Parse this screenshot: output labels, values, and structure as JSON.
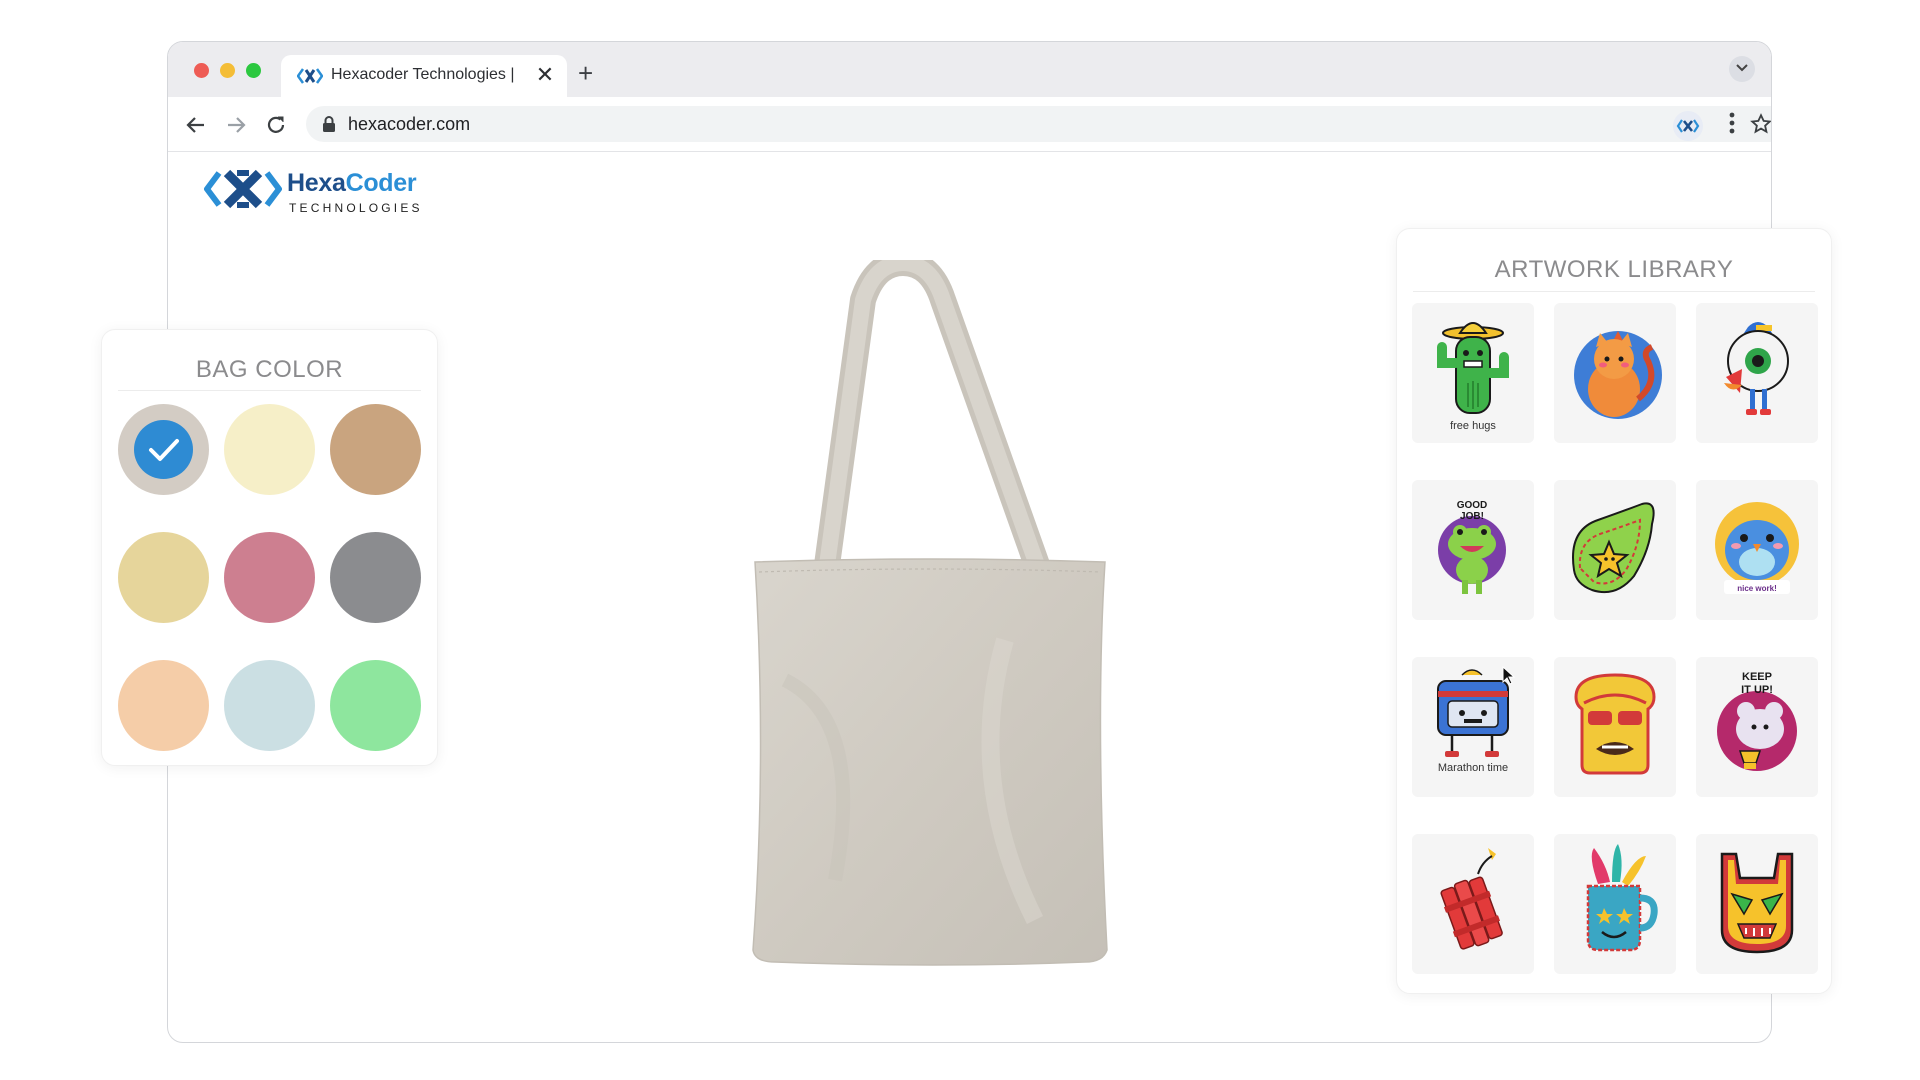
{
  "browser": {
    "tab_title": "Hexacoder Technologies |",
    "new_tab_label": "+",
    "close_label": "✕",
    "url": "hexacoder.com"
  },
  "site": {
    "logo_main_a": "Hexa",
    "logo_main_b": "Coder",
    "logo_sub": "TECHNOLOGIES"
  },
  "bag_color": {
    "title": "BAG COLOR",
    "selected_index": 0,
    "swatches": [
      "#d3ccc4",
      "#f6efc8",
      "#c9a47f",
      "#e6d59b",
      "#cd7f90",
      "#8b8c8f",
      "#f5cda8",
      "#cbdfe3",
      "#8ee69e"
    ]
  },
  "artwork_library": {
    "title": "ARTWORK LIBRARY",
    "items": [
      {
        "name": "cactus-sticker",
        "caption": "free hugs"
      },
      {
        "name": "cat-sticker",
        "caption": ""
      },
      {
        "name": "eyeball-sticker",
        "caption": ""
      },
      {
        "name": "frog-sticker",
        "caption": "GOOD JOB!"
      },
      {
        "name": "star-fireball-sticker",
        "caption": ""
      },
      {
        "name": "owl-sticker",
        "caption": "nice work!"
      },
      {
        "name": "running-robot-sticker",
        "caption": "Marathon time"
      },
      {
        "name": "toast-sticker",
        "caption": ""
      },
      {
        "name": "mouse-trophy-sticker",
        "caption": "KEEP IT UP!"
      },
      {
        "name": "dynamite-sticker",
        "caption": ""
      },
      {
        "name": "mug-sticker",
        "caption": ""
      },
      {
        "name": "tiki-mask-sticker",
        "caption": ""
      }
    ]
  },
  "colors": {
    "accent": "#2e8bd3",
    "title_gray": "#8b8b8d",
    "bag": "#d2cdc4"
  }
}
